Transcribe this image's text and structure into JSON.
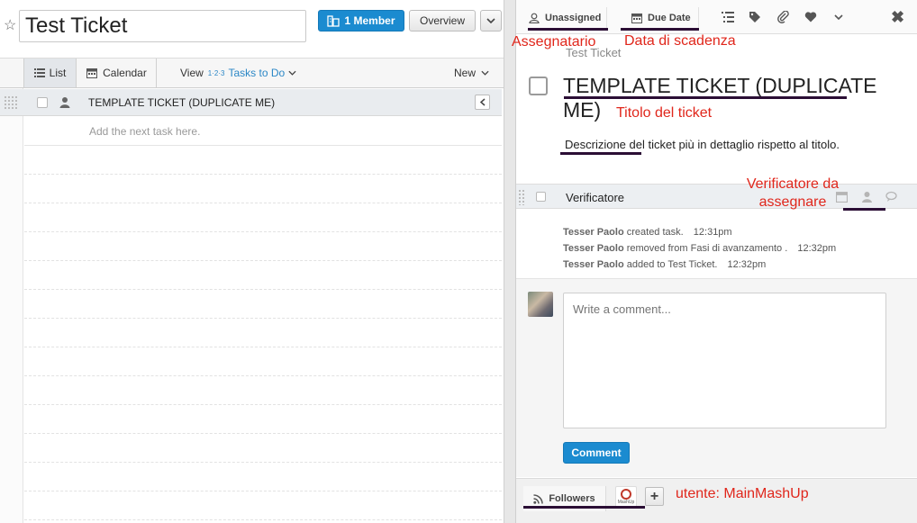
{
  "left": {
    "title_value": "Test Ticket",
    "member_label": "1 Member",
    "overview_label": "Overview",
    "tabs": {
      "list": "List",
      "calendar": "Calendar"
    },
    "view_label": "View",
    "view_filter": "Tasks to Do",
    "view_filter_sup": "1·2·3",
    "new_label": "New",
    "task": {
      "label": "TEMPLATE TICKET (DUPLICATE ME)"
    },
    "add_task_placeholder": "Add the next task here."
  },
  "right": {
    "assignee_label": "Unassigned",
    "due_date_label": "Due Date",
    "close_symbol": "✖",
    "breadcrumb": "Test Ticket",
    "ticket_title": "TEMPLATE TICKET (DUPLICATE ME)",
    "description": "Descrizione del ticket più in dettaglio rispetto al titolo.",
    "subtask_label": "Verificatore",
    "activity": [
      {
        "who": "Tesser Paolo",
        "what": "created task.",
        "time": "12:31pm"
      },
      {
        "who": "Tesser Paolo",
        "what": "removed from Fasi di avanzamento .",
        "time": "12:32pm"
      },
      {
        "who": "Tesser Paolo",
        "what": "added to Test Ticket.",
        "time": "12:32pm"
      }
    ],
    "comment_placeholder": "Write a comment...",
    "comment_button": "Comment",
    "followers_label": "Followers",
    "follower_avatar_text": "MashUp",
    "add_follower_symbol": "+"
  },
  "annotations": {
    "assignee": "Assegnatario",
    "due_date": "Data di scadenza",
    "title": "Titolo del ticket",
    "verifier_line1": "Verificatore da",
    "verifier_line2": "assegnare",
    "user": "utente: MainMashUp"
  },
  "colors": {
    "primary_button": "#1b8bd0",
    "link_blue": "#2b87c6",
    "annotation_red": "#e0261b",
    "annotation_underline": "#2b0e35"
  }
}
